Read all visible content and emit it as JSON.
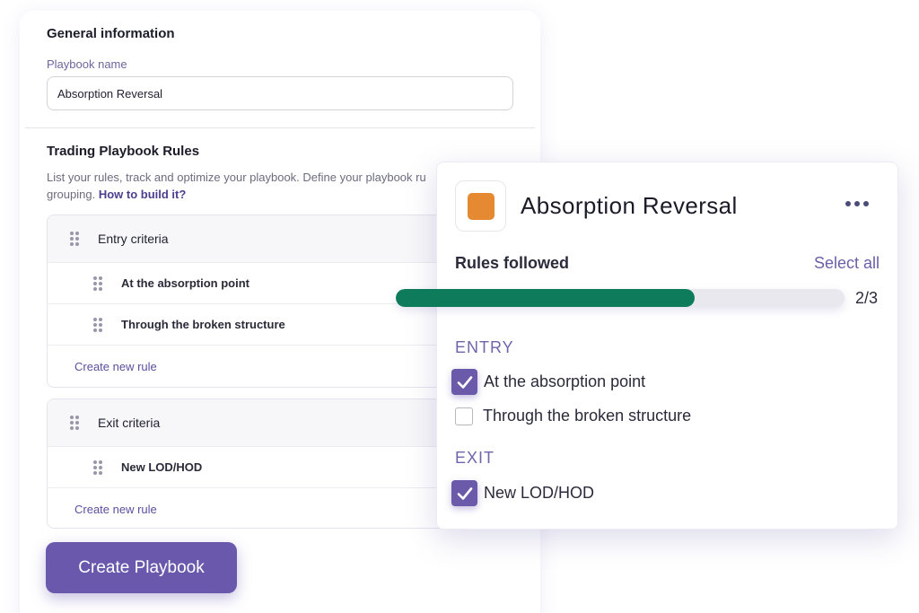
{
  "form": {
    "general_title": "General information",
    "playbook_name_label": "Playbook name",
    "playbook_name_value": "Absorption Reversal",
    "rules_title": "Trading Playbook Rules",
    "rules_description": "List your rules, track and optimize your playbook. Define your playbook ru grouping.",
    "how_to_link": "How to build it?",
    "groups": [
      {
        "title": "Entry criteria",
        "rules": [
          "At the absorption point",
          "Through the broken structure"
        ],
        "create_label": "Create new rule"
      },
      {
        "title": "Exit criteria",
        "rules": [
          "New LOD/HOD"
        ],
        "create_label": "Create new rule"
      }
    ],
    "create_button": "Create Playbook"
  },
  "overlay": {
    "title": "Absorption Reversal",
    "swatch_color": "#e58a32",
    "more_icon": "more-horizontal-icon",
    "rules_followed_label": "Rules followed",
    "select_all_label": "Select all",
    "progress": {
      "followed": 2,
      "total": 3,
      "text": "2/3"
    },
    "progress_color": "#0e7c5a",
    "categories": [
      {
        "label": "ENTRY",
        "items": [
          {
            "label": "At the absorption point",
            "checked": true
          },
          {
            "label": "Through the broken structure",
            "checked": false
          }
        ]
      },
      {
        "label": "EXIT",
        "items": [
          {
            "label": "New LOD/HOD",
            "checked": true
          }
        ]
      }
    ],
    "accent_color": "#6a5aa9"
  }
}
